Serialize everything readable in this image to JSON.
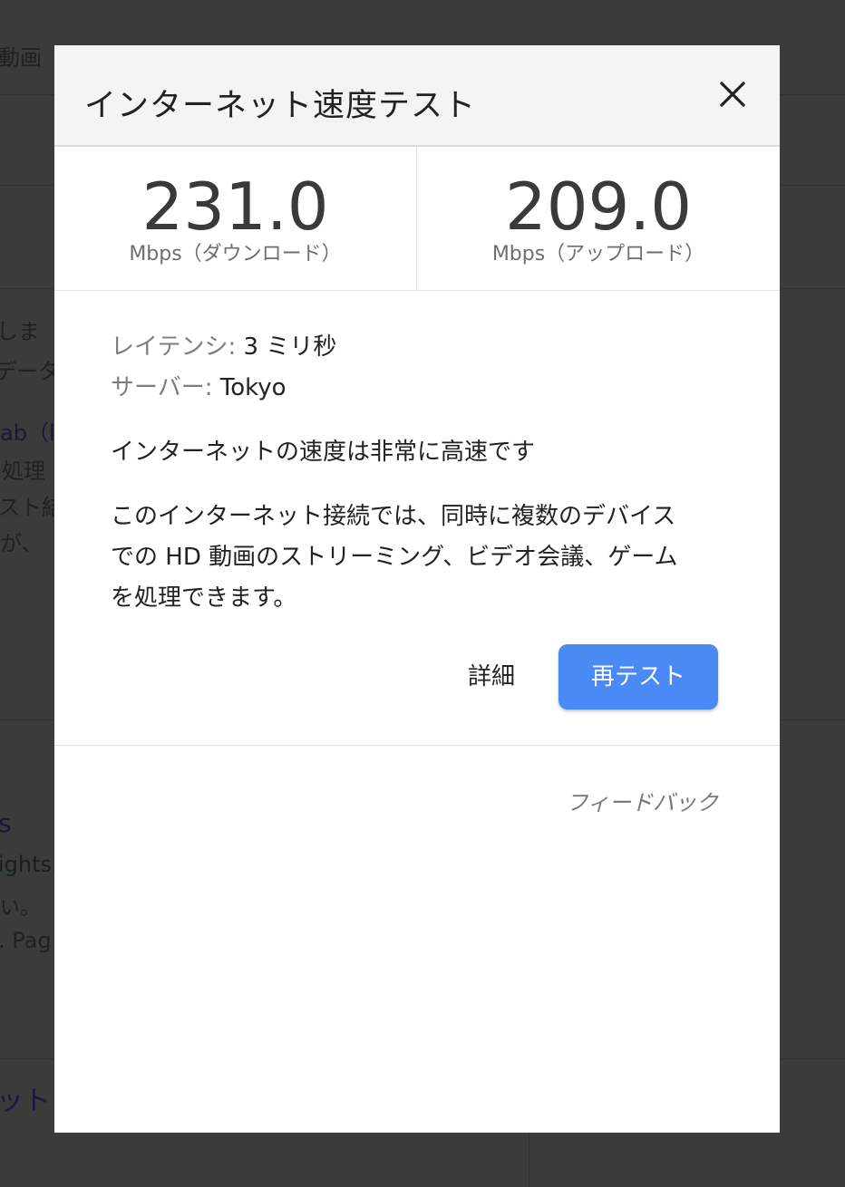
{
  "background": {
    "snippets": [
      {
        "id": "nav-video",
        "text": "動画"
      },
      {
        "id": "bg-line-1",
        "text": "しま"
      },
      {
        "id": "bg-line-2",
        "text": "データ"
      },
      {
        "id": "bg-line-3",
        "text": "ab（l"
      },
      {
        "id": "bg-line-4",
        "text": "処理"
      },
      {
        "id": "bg-line-5",
        "text": "スト結"
      },
      {
        "id": "bg-line-6",
        "text": "が、"
      },
      {
        "id": "bg-line-7",
        "text": "s"
      },
      {
        "id": "bg-line-8",
        "text": "ights."
      },
      {
        "id": "bg-line-9",
        "text": "い。"
      },
      {
        "id": "bg-line-10",
        "text": ". Pag"
      },
      {
        "id": "bg-line-11",
        "text": "ット"
      }
    ]
  },
  "dialog": {
    "title": "インターネット速度テスト",
    "close_icon": "close-icon",
    "download": {
      "value": "231.0",
      "unit": "Mbps（ダウンロード）"
    },
    "upload": {
      "value": "209.0",
      "unit": "Mbps（アップロード）"
    },
    "latency": {
      "label": "レイテンシ:",
      "value": "3 ミリ秒"
    },
    "server": {
      "label": "サーバー:",
      "value": "Tokyo"
    },
    "summary": "インターネットの速度は非常に高速です",
    "description": "このインターネット接続では、同時に複数のデバイス\nでの HD 動画のストリーミング、ビデオ会議、ゲーム\nを処理できます。",
    "details_label": "詳細",
    "retest_label": "再テスト",
    "feedback_label": "フィードバック"
  },
  "colors": {
    "accent": "#4a8af4",
    "overlay": "#3b3b3b"
  }
}
